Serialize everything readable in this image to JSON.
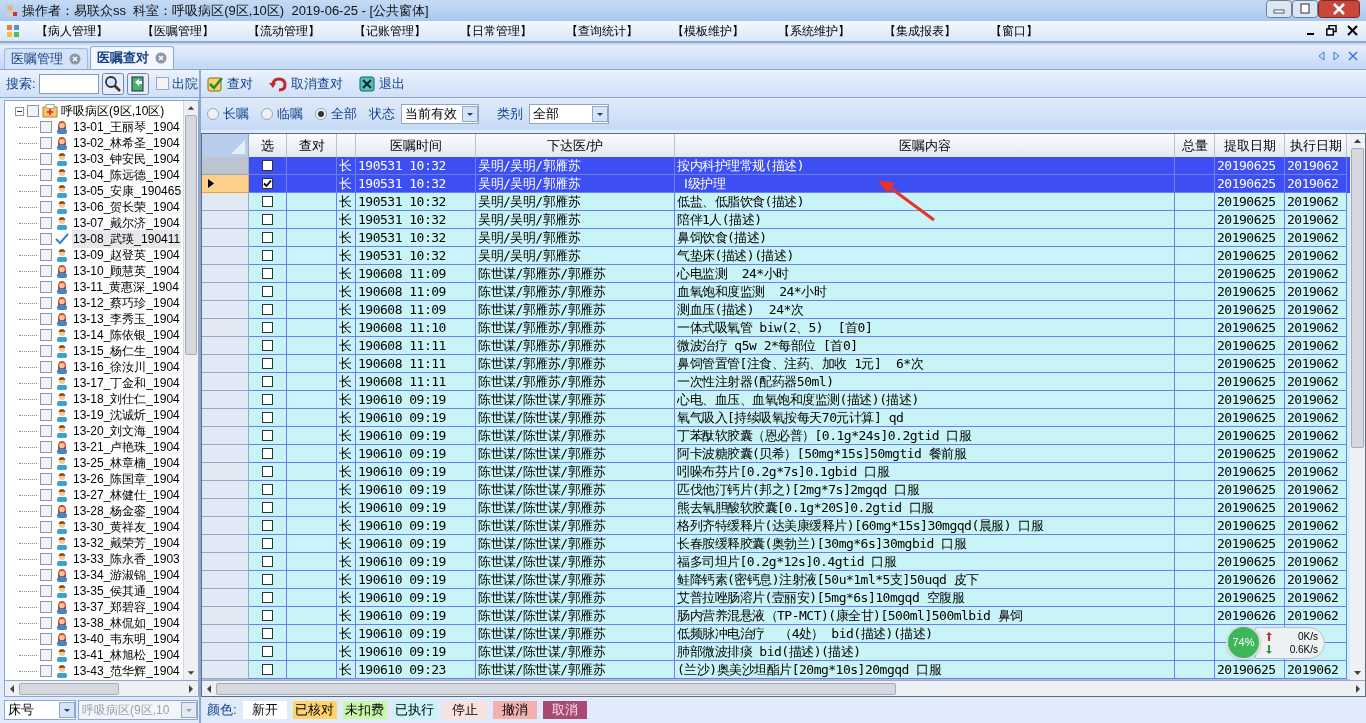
{
  "window": {
    "title": "操作者：易联众ss  科室：呼吸病区(9区,10区)  2019-06-25 - [公共窗体]"
  },
  "menu": [
    "【病人管理】",
    "【医嘱管理】",
    "【流动管理】",
    "【记账管理】",
    "【日常管理】",
    "【查询统计】",
    "【模板维护】",
    "【系统维护】",
    "【集成报表】",
    "【窗口】"
  ],
  "tabs": [
    {
      "label": "医嘱管理",
      "selected": false
    },
    {
      "label": "医嘱查对",
      "selected": true
    }
  ],
  "search": {
    "label": "搜索:",
    "discharged_label": "出院",
    "discharged_checked": false
  },
  "toolbar": [
    "查对",
    "取消查对",
    "退出"
  ],
  "tree": {
    "label": "呼吸病区(9区,10区)",
    "expanded": true,
    "checked": false,
    "children": [
      {
        "label": "13-01_王丽琴_1904",
        "kind": "female",
        "selected": false,
        "checked": false
      },
      {
        "label": "13-02_林希圣_1904",
        "kind": "female",
        "selected": false,
        "checked": false
      },
      {
        "label": "13-03_钟安民_1904",
        "kind": "male",
        "selected": false,
        "checked": false
      },
      {
        "label": "13-04_陈远德_1904",
        "kind": "male",
        "selected": false,
        "checked": false
      },
      {
        "label": "13-05_安康_190465",
        "kind": "male",
        "selected": false,
        "checked": false
      },
      {
        "label": "13-06_贺长荣_1904",
        "kind": "male",
        "selected": false,
        "checked": false
      },
      {
        "label": "13-07_戴尔济_1904",
        "kind": "male",
        "selected": false,
        "checked": false
      },
      {
        "label": "13-08_武瑛_190411",
        "kind": "done",
        "selected": true,
        "checked": false
      },
      {
        "label": "13-09_赵登英_1904",
        "kind": "male",
        "selected": false,
        "checked": false
      },
      {
        "label": "13-10_顾慧英_1904",
        "kind": "female",
        "selected": false,
        "checked": false
      },
      {
        "label": "13-11_黄惠深_1904",
        "kind": "female",
        "selected": false,
        "checked": false
      },
      {
        "label": "13-12_蔡巧珍_1904",
        "kind": "female",
        "selected": false,
        "checked": false
      },
      {
        "label": "13-13_李秀玉_1904",
        "kind": "female",
        "selected": false,
        "checked": false
      },
      {
        "label": "13-14_陈依银_1904",
        "kind": "male",
        "selected": false,
        "checked": false
      },
      {
        "label": "13-15_杨仁生_1904",
        "kind": "male",
        "selected": false,
        "checked": false
      },
      {
        "label": "13-16_徐汝川_1904",
        "kind": "female",
        "selected": false,
        "checked": false
      },
      {
        "label": "13-17_丁金和_1904",
        "kind": "male",
        "selected": false,
        "checked": false
      },
      {
        "label": "13-18_刘仕仁_1904",
        "kind": "male",
        "selected": false,
        "checked": false
      },
      {
        "label": "13-19_沈诚炘_1904",
        "kind": "male",
        "selected": false,
        "checked": false
      },
      {
        "label": "13-20_刘文海_1904",
        "kind": "male",
        "selected": false,
        "checked": false
      },
      {
        "label": "13-21_卢艳珠_1904",
        "kind": "female",
        "selected": false,
        "checked": false
      },
      {
        "label": "13-25_林章楠_1904",
        "kind": "male",
        "selected": false,
        "checked": false
      },
      {
        "label": "13-26_陈国章_1904",
        "kind": "male",
        "selected": false,
        "checked": false
      },
      {
        "label": "13-27_林健仕_1904",
        "kind": "male",
        "selected": false,
        "checked": false
      },
      {
        "label": "13-28_杨金銮_1904",
        "kind": "female",
        "selected": false,
        "checked": false
      },
      {
        "label": "13-30_黄祥友_1904",
        "kind": "male",
        "selected": false,
        "checked": false
      },
      {
        "label": "13-32_戴荣芳_1904",
        "kind": "male",
        "selected": false,
        "checked": false
      },
      {
        "label": "13-33_陈永香_1903",
        "kind": "male",
        "selected": false,
        "checked": false
      },
      {
        "label": "13-34_游淑锦_1904",
        "kind": "female",
        "selected": false,
        "checked": false
      },
      {
        "label": "13-35_侯其通_1904",
        "kind": "male",
        "selected": false,
        "checked": false
      },
      {
        "label": "13-37_郑碧容_1904",
        "kind": "female",
        "selected": false,
        "checked": false
      },
      {
        "label": "13-38_林侃如_1904",
        "kind": "female",
        "selected": false,
        "checked": false
      },
      {
        "label": "13-40_韦东明_1904",
        "kind": "female",
        "selected": false,
        "checked": false
      },
      {
        "label": "13-41_林旭松_1904",
        "kind": "male",
        "selected": false,
        "checked": false
      },
      {
        "label": "13-43_范华辉_1904",
        "kind": "male",
        "selected": false,
        "checked": false
      }
    ]
  },
  "sort_select": {
    "value": "床号"
  },
  "ward_select": {
    "value": "呼吸病区(9区,10",
    "disabled": true
  },
  "filter": {
    "radios": [
      {
        "label": "长嘱",
        "selected": false
      },
      {
        "label": "临嘱",
        "selected": false
      },
      {
        "label": "全部",
        "selected": true
      }
    ],
    "status_label": "状态",
    "status_value": "当前有效",
    "category_label": "类别",
    "category_value": "全部"
  },
  "table": {
    "columns": [
      "选",
      "查对",
      "",
      "医嘱时间",
      "下达医/护",
      "医嘱内容",
      "总量",
      "提取日期",
      "执行日期"
    ],
    "rows": [
      {
        "checked": false,
        "selected": true,
        "current": false,
        "type": "长",
        "time": "190531 10:32",
        "doctor": "吴明/吴明/郭雁苏",
        "content": "按内科护理常规(描述)",
        "extract_date": "20190625",
        "exec_date": "2019062"
      },
      {
        "checked": true,
        "selected": true,
        "current": true,
        "type": "长",
        "time": "190531 10:32",
        "doctor": "吴明/吴明/郭雁苏",
        "content": " Ⅰ级护理",
        "extract_date": "20190625",
        "exec_date": "2019062"
      },
      {
        "checked": false,
        "selected": false,
        "current": false,
        "type": "长",
        "time": "190531 10:32",
        "doctor": "吴明/吴明/郭雁苏",
        "content": "低盐、低脂饮食(描述)",
        "extract_date": "20190625",
        "exec_date": "2019062"
      },
      {
        "checked": false,
        "selected": false,
        "current": false,
        "type": "长",
        "time": "190531 10:32",
        "doctor": "吴明/吴明/郭雁苏",
        "content": "陪伴1人(描述)",
        "extract_date": "20190625",
        "exec_date": "2019062"
      },
      {
        "checked": false,
        "selected": false,
        "current": false,
        "type": "长",
        "time": "190531 10:32",
        "doctor": "吴明/吴明/郭雁苏",
        "content": "鼻饲饮食(描述)",
        "extract_date": "20190625",
        "exec_date": "2019062"
      },
      {
        "checked": false,
        "selected": false,
        "current": false,
        "type": "长",
        "time": "190531 10:32",
        "doctor": "吴明/吴明/郭雁苏",
        "content": "气垫床(描述)(描述)",
        "extract_date": "20190625",
        "exec_date": "2019062"
      },
      {
        "checked": false,
        "selected": false,
        "current": false,
        "type": "长",
        "time": "190608 11:09",
        "doctor": "陈世谋/郭雁苏/郭雁苏",
        "content": "心电监测  24*小时",
        "extract_date": "20190625",
        "exec_date": "2019062"
      },
      {
        "checked": false,
        "selected": false,
        "current": false,
        "type": "长",
        "time": "190608 11:09",
        "doctor": "陈世谋/郭雁苏/郭雁苏",
        "content": "血氧饱和度监测  24*小时",
        "extract_date": "20190625",
        "exec_date": "2019062"
      },
      {
        "checked": false,
        "selected": false,
        "current": false,
        "type": "长",
        "time": "190608 11:09",
        "doctor": "陈世谋/郭雁苏/郭雁苏",
        "content": "测血压(描述)  24*次",
        "extract_date": "20190625",
        "exec_date": "2019062"
      },
      {
        "checked": false,
        "selected": false,
        "current": false,
        "type": "长",
        "time": "190608 11:10",
        "doctor": "陈世谋/郭雁苏/郭雁苏",
        "content": "一体式吸氧管 biw(2、5)  [首0]",
        "extract_date": "20190625",
        "exec_date": "2019062"
      },
      {
        "checked": false,
        "selected": false,
        "current": false,
        "type": "长",
        "time": "190608 11:11",
        "doctor": "陈世谋/郭雁苏/郭雁苏",
        "content": "微波治疗 q5w 2*每部位 [首0]",
        "extract_date": "20190625",
        "exec_date": "2019062"
      },
      {
        "checked": false,
        "selected": false,
        "current": false,
        "type": "长",
        "time": "190608 11:11",
        "doctor": "陈世谋/郭雁苏/郭雁苏",
        "content": "鼻饲管置管[注食、注药、加收 1元]  6*次",
        "extract_date": "20190625",
        "exec_date": "2019062"
      },
      {
        "checked": false,
        "selected": false,
        "current": false,
        "type": "长",
        "time": "190608 11:11",
        "doctor": "陈世谋/郭雁苏/郭雁苏",
        "content": "一次性注射器(配药器50ml)",
        "extract_date": "20190625",
        "exec_date": "2019062"
      },
      {
        "checked": false,
        "selected": false,
        "current": false,
        "type": "长",
        "time": "190610 09:19",
        "doctor": "陈世谋/陈世谋/郭雁苏",
        "content": "心电、血压、血氧饱和度监测(描述)(描述)",
        "extract_date": "20190625",
        "exec_date": "2019062"
      },
      {
        "checked": false,
        "selected": false,
        "current": false,
        "type": "长",
        "time": "190610 09:19",
        "doctor": "陈世谋/陈世谋/郭雁苏",
        "content": "氧气吸入[持续吸氧按每天70元计算] qd",
        "extract_date": "20190625",
        "exec_date": "2019062"
      },
      {
        "checked": false,
        "selected": false,
        "current": false,
        "type": "长",
        "time": "190610 09:19",
        "doctor": "陈世谋/陈世谋/郭雁苏",
        "content": "丁苯酞软胶囊（恩必普）[0.1g*24s]0.2gtid 口服",
        "extract_date": "20190625",
        "exec_date": "2019062"
      },
      {
        "checked": false,
        "selected": false,
        "current": false,
        "type": "长",
        "time": "190610 09:19",
        "doctor": "陈世谋/陈世谋/郭雁苏",
        "content": "阿卡波糖胶囊(贝希）[50mg*15s]50mgtid 餐前服",
        "extract_date": "20190625",
        "exec_date": "2019062"
      },
      {
        "checked": false,
        "selected": false,
        "current": false,
        "type": "长",
        "time": "190610 09:19",
        "doctor": "陈世谋/陈世谋/郭雁苏",
        "content": "吲哚布芬片[0.2g*7s]0.1gbid 口服",
        "extract_date": "20190625",
        "exec_date": "2019062"
      },
      {
        "checked": false,
        "selected": false,
        "current": false,
        "type": "长",
        "time": "190610 09:19",
        "doctor": "陈世谋/陈世谋/郭雁苏",
        "content": "匹伐他汀钙片(邦之)[2mg*7s]2mgqd 口服",
        "extract_date": "20190625",
        "exec_date": "2019062"
      },
      {
        "checked": false,
        "selected": false,
        "current": false,
        "type": "长",
        "time": "190610 09:19",
        "doctor": "陈世谋/陈世谋/郭雁苏",
        "content": "熊去氧胆酸软胶囊[0.1g*20S]0.2gtid 口服",
        "extract_date": "20190625",
        "exec_date": "2019062"
      },
      {
        "checked": false,
        "selected": false,
        "current": false,
        "type": "长",
        "time": "190610 09:19",
        "doctor": "陈世谋/陈世谋/郭雁苏",
        "content": "格列齐特缓释片(达美康缓释片)[60mg*15s]30mgqd(晨服) 口服",
        "extract_date": "20190625",
        "exec_date": "2019062"
      },
      {
        "checked": false,
        "selected": false,
        "current": false,
        "type": "长",
        "time": "190610 09:19",
        "doctor": "陈世谋/陈世谋/郭雁苏",
        "content": "长春胺缓释胶囊(奥勃兰)[30mg*6s]30mgbid 口服",
        "extract_date": "20190625",
        "exec_date": "2019062"
      },
      {
        "checked": false,
        "selected": false,
        "current": false,
        "type": "长",
        "time": "190610 09:19",
        "doctor": "陈世谋/陈世谋/郭雁苏",
        "content": "福多司坦片[0.2g*12s]0.4gtid 口服",
        "extract_date": "20190625",
        "exec_date": "2019062"
      },
      {
        "checked": false,
        "selected": false,
        "current": false,
        "type": "长",
        "time": "190610 09:19",
        "doctor": "陈世谋/陈世谋/郭雁苏",
        "content": "鲑降钙素(密钙息)注射液[50u*1ml*5支]50uqd 皮下",
        "extract_date": "20190626",
        "exec_date": "2019062"
      },
      {
        "checked": false,
        "selected": false,
        "current": false,
        "type": "长",
        "time": "190610 09:19",
        "doctor": "陈世谋/陈世谋/郭雁苏",
        "content": "艾普拉唑肠溶片(壹丽安)[5mg*6s]10mgqd 空腹服",
        "extract_date": "20190625",
        "exec_date": "2019062"
      },
      {
        "checked": false,
        "selected": false,
        "current": false,
        "type": "长",
        "time": "190610 09:19",
        "doctor": "陈世谋/陈世谋/郭雁苏",
        "content": "肠内营养混悬液（TP-MCT)(康全甘)[500ml]500mlbid 鼻饲",
        "extract_date": "20190626",
        "exec_date": "2019062"
      },
      {
        "checked": false,
        "selected": false,
        "current": false,
        "type": "长",
        "time": "190610 09:19",
        "doctor": "陈世谋/陈世谋/郭雁苏",
        "content": "低频脉冲电治疗  （4处） bid(描述)(描述)"
      },
      {
        "checked": false,
        "selected": false,
        "current": false,
        "type": "长",
        "time": "190610 09:19",
        "doctor": "陈世谋/陈世谋/郭雁苏",
        "content": "肺部微波排痰 bid(描述)(描述)"
      },
      {
        "checked": false,
        "selected": false,
        "current": false,
        "type": "长",
        "time": "190610 09:23",
        "doctor": "陈世谋/陈世谋/郭雁苏",
        "content": "(兰沙)奥美沙坦酯片[20mg*10s]20mgqd 口服",
        "extract_date": "20190625",
        "exec_date": "2019062"
      }
    ]
  },
  "legend": {
    "label": "颜色:",
    "items": [
      {
        "label": "新开",
        "color": "#ffffff"
      },
      {
        "label": "已核对",
        "color": "#ffd36b"
      },
      {
        "label": "未扣费",
        "color": "#c9f7a8"
      },
      {
        "label": "已执行",
        "color": "#c8f4f8"
      },
      {
        "label": "停止",
        "color": "#fbe0e0"
      },
      {
        "label": "撤消",
        "color": "#f4b0b0"
      },
      {
        "label": "取消",
        "color": "#a84a72"
      }
    ]
  },
  "net_widget": {
    "percent": "74%",
    "up": "0K/s",
    "down": "0.6K/s"
  }
}
